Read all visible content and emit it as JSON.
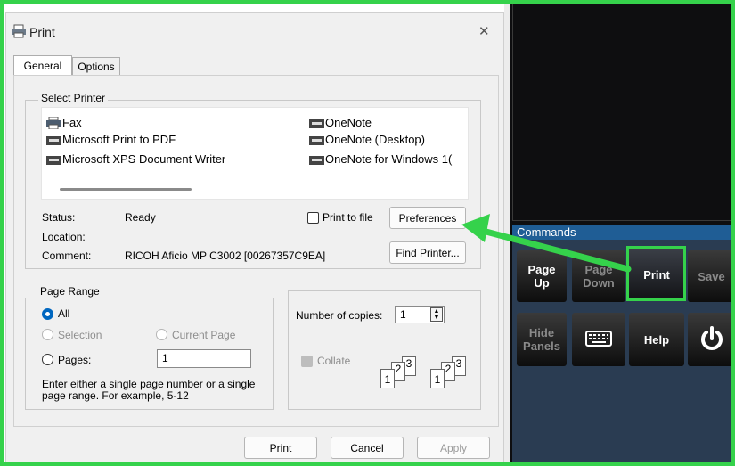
{
  "dialog": {
    "title": "Print",
    "close_glyph": "✕",
    "tabs": [
      "General",
      "Options"
    ],
    "select_printer": {
      "label": "Select Printer",
      "printers_left": [
        "Fax",
        "Microsoft Print to PDF",
        "Microsoft XPS Document Writer"
      ],
      "printers_right": [
        "OneNote",
        "OneNote (Desktop)",
        "OneNote for Windows 1("
      ]
    },
    "status": {
      "status_label": "Status:",
      "status_value": "Ready",
      "location_label": "Location:",
      "location_value": "",
      "comment_label": "Comment:",
      "comment_value": "RICOH Aficio MP C3002 [00267357C9EA]"
    },
    "print_to_file_label": "Print to file",
    "preferences_button": "Preferences",
    "find_printer_button": "Find Printer...",
    "page_range": {
      "label": "Page Range",
      "all": "All",
      "selection": "Selection",
      "current_page": "Current Page",
      "pages": "Pages:",
      "pages_value": "1",
      "hint": "Enter either a single page number or a single page range.  For example, 5-12"
    },
    "copies": {
      "label": "Number of copies:",
      "value": "1",
      "collate_label": "Collate",
      "collate_digits": [
        "1",
        "2",
        "3"
      ]
    },
    "buttons": {
      "print": "Print",
      "cancel": "Cancel",
      "apply": "Apply"
    }
  },
  "commands": {
    "header": "Commands",
    "buttons": [
      {
        "label": "Page Up"
      },
      {
        "label": "Page Down"
      },
      {
        "label": "Print"
      },
      {
        "label": "Save"
      },
      {
        "label": "Hide Panels"
      },
      {
        "label": "keyboard",
        "icon": "keyboard-icon"
      },
      {
        "label": "Help"
      },
      {
        "label": "power",
        "icon": "power-icon"
      }
    ]
  },
  "colors": {
    "highlight": "#35d24b",
    "accent": "#0067c0",
    "commands_bar": "#1f5d95"
  }
}
